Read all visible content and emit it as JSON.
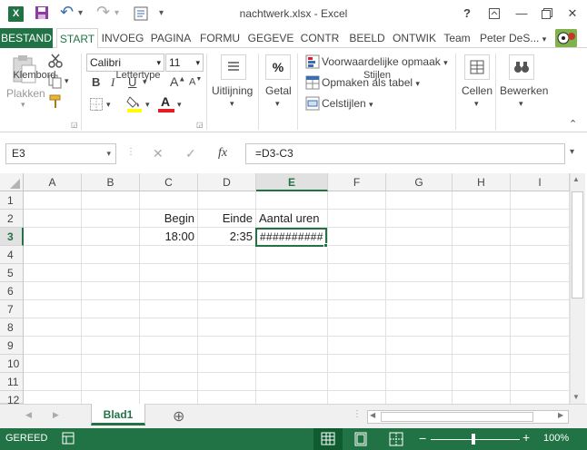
{
  "window": {
    "title": "nachtwerk.xlsx - Excel",
    "help": "?",
    "ribbon_display": "⬚",
    "minimize": "—",
    "restore": "❐",
    "close": "✕"
  },
  "qat": {
    "save": "💾",
    "undo": "↶",
    "undo_drop": "▾",
    "redo": "↷",
    "redo_drop": "▾",
    "customize": "▾"
  },
  "tabs": {
    "file": "BESTAND",
    "home": "START",
    "insert": "INVOEG",
    "page": "PAGINA",
    "formulas": "FORMU",
    "data": "GEGEVE",
    "review": "CONTR",
    "view": "BEELD",
    "developer": "ONTWIK",
    "team": "Team",
    "user": "Peter DeS..."
  },
  "ribbon": {
    "clipboard": {
      "paste": "Plakken",
      "label": "Klembord"
    },
    "font": {
      "name": "Calibri",
      "size": "11",
      "bold": "B",
      "italic": "I",
      "underline": "U",
      "grow": "A",
      "shrink": "A",
      "fontcolor": "A",
      "label": "Lettertype"
    },
    "alignment": {
      "label": "Uitlijning"
    },
    "number": {
      "symbol": "%",
      "label": "Getal"
    },
    "styles": {
      "conditional": "Voorwaardelijke opmaak",
      "table": "Opmaken als tabel",
      "cellstyles": "Celstijlen",
      "label": "Stijlen"
    },
    "cells": {
      "label": "Cellen"
    },
    "editing": {
      "label": "Bewerken"
    }
  },
  "formula_bar": {
    "name_box": "E3",
    "cancel": "✕",
    "enter": "✓",
    "fx": "fx",
    "formula": "=D3-C3"
  },
  "grid": {
    "columns": [
      "A",
      "B",
      "C",
      "D",
      "E",
      "F",
      "G",
      "H",
      "I"
    ],
    "rows": [
      "1",
      "2",
      "3",
      "4",
      "5",
      "6",
      "7",
      "8",
      "9",
      "10",
      "11",
      "12"
    ],
    "cells": {
      "C2": "Begin",
      "D2": "Einde",
      "E2": "Aantal uren",
      "C3": "18:00",
      "D3": "2:35",
      "E3": "##########"
    }
  },
  "sheets": {
    "active": "Blad1",
    "add": "⊕"
  },
  "status": {
    "mode": "GEREED",
    "zoom": "100%",
    "zoom_out": "−",
    "zoom_in": "+"
  },
  "colors": {
    "accent": "#217346",
    "header_bg": "#f3f3f3",
    "selected_header_bg": "#e1e1e1"
  }
}
